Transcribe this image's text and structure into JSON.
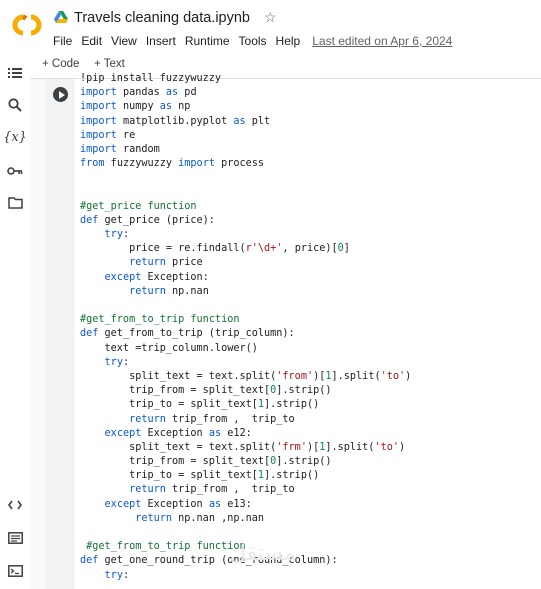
{
  "app": {
    "logo": "colab-logo",
    "notebook_title": "Travels cleaning data.ipynb",
    "last_edited": "Last edited on Apr 6, 2024"
  },
  "menu": [
    "File",
    "Edit",
    "View",
    "Insert",
    "Runtime",
    "Tools",
    "Help"
  ],
  "toolbar": {
    "code_label": "+ Code",
    "text_label": "+ Text"
  },
  "sidebar_icons": [
    "table-of-contents-icon",
    "search-icon",
    "variables-icon",
    "secrets-key-icon",
    "files-folder-icon",
    "code-snippets-icon",
    "command-palette-icon",
    "terminal-icon"
  ],
  "code_lines": [
    "!pip install fuzzywuzzy",
    "import pandas as pd",
    "import numpy as np",
    "import matplotlib.pyplot as plt",
    "import re",
    "import random",
    "from fuzzywuzzy import process",
    "",
    "",
    "#get_price function",
    "def get_price (price):",
    "    try:",
    "        price = re.findall(r'\\d+', price)[0]",
    "        return price",
    "    except Exception:",
    "        return np.nan",
    "",
    "#get_from_to_trip function",
    "def get_from_to_trip (trip_column):",
    "    text =trip_column.lower()",
    "    try:",
    "        split_text = text.split('from')[1].split('to')",
    "        trip_from = split_text[0].strip()",
    "        trip_to = split_text[1].strip()",
    "        return trip_from ,  trip_to",
    "    except Exception as e12:",
    "        split_text = text.split('frm')[1].split('to')",
    "        trip_from = split_text[0].strip()",
    "        trip_to = split_text[1].strip()",
    "        return trip_from ,  trip_to",
    "    except Exception as e13:",
    "         return np.nan ,np.nan",
    "",
    " #get_from_to_trip function",
    "def get_one_round_trip (one_round_column):",
    "    try:"
  ],
  "watermark": "مستقل"
}
